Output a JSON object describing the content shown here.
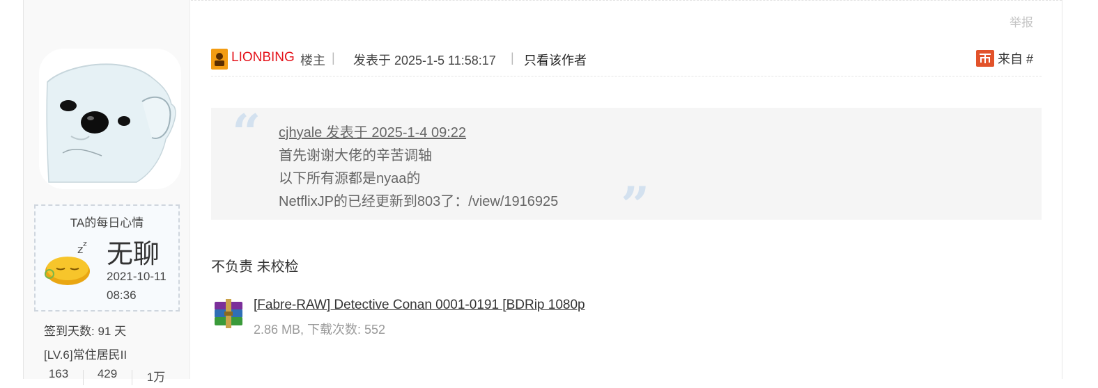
{
  "post": {
    "report_label": "举报",
    "author": "LIONBING",
    "author_role": "楼主",
    "separator": "|",
    "post_time": "发表于 2025-1-5 11:58:17",
    "only_author_label": "只看该作者",
    "from_label": "来自 #",
    "body_text": "不负责 未校检"
  },
  "quote": {
    "header": "cjhyale 发表于 2025-1-4 09:22",
    "lines": [
      "首先谢谢大佬的辛苦调轴",
      "以下所有源都是nyaa的",
      "NetflixJP的已经更新到803了：/view/1916925"
    ]
  },
  "attachment": {
    "name": "[Fabre-RAW] Detective Conan 0001-0191 [BDRip 1080p",
    "meta": "2.86 MB, 下载次数: 552"
  },
  "profile": {
    "mood_title": "TA的每日心情",
    "mood_word": "无聊",
    "mood_date": "2021-10-11 08:36",
    "sign_days": "签到天数: 91 天",
    "level": "[LV.6]常住居民II",
    "stats": [
      "163",
      "429",
      "1万"
    ]
  },
  "colors": {
    "author": "#e4131b",
    "quote_bg": "#f5f5f5",
    "quote_mark": "#d3e1ef"
  }
}
